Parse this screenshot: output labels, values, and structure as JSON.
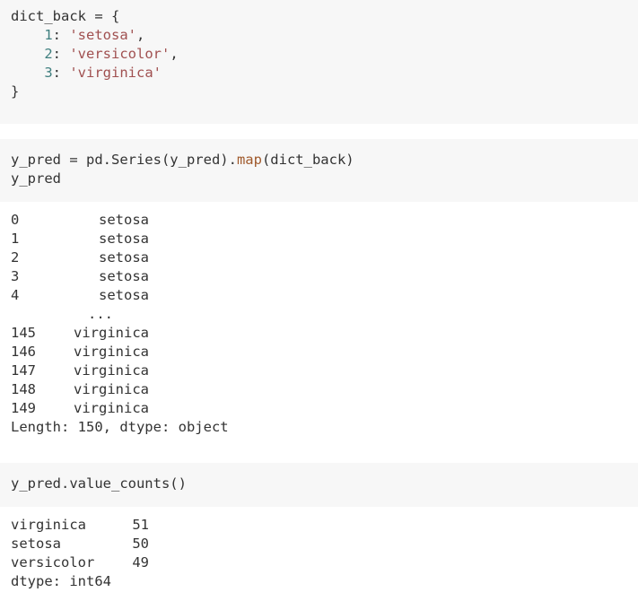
{
  "cell1": {
    "line1": "dict_back = {",
    "entries": [
      {
        "key": "1",
        "value": "'setosa'",
        "suffix": ","
      },
      {
        "key": "2",
        "value": "'versicolor'",
        "suffix": ","
      },
      {
        "key": "3",
        "value": "'virginica'",
        "suffix": ""
      }
    ],
    "closing": "}"
  },
  "cell2": {
    "line1_a": "y_pred = pd.Series(y_pred).",
    "line1_fn": "map",
    "line1_b": "(dict_back)",
    "line2": "y_pred"
  },
  "output2": {
    "rows_head": [
      {
        "index": "0",
        "value": "setosa"
      },
      {
        "index": "1",
        "value": "setosa"
      },
      {
        "index": "2",
        "value": "setosa"
      },
      {
        "index": "3",
        "value": "setosa"
      },
      {
        "index": "4",
        "value": "setosa"
      }
    ],
    "ellipsis": "...",
    "rows_tail": [
      {
        "index": "145",
        "value": "virginica"
      },
      {
        "index": "146",
        "value": "virginica"
      },
      {
        "index": "147",
        "value": "virginica"
      },
      {
        "index": "148",
        "value": "virginica"
      },
      {
        "index": "149",
        "value": "virginica"
      }
    ],
    "footer": "Length: 150, dtype: object"
  },
  "cell3": {
    "line1": "y_pred.value_counts()"
  },
  "output3": {
    "rows": [
      {
        "name": "virginica",
        "count": "51"
      },
      {
        "name": "setosa",
        "count": "50"
      },
      {
        "name": "versicolor",
        "count": "49"
      }
    ],
    "footer": "dtype: int64"
  }
}
